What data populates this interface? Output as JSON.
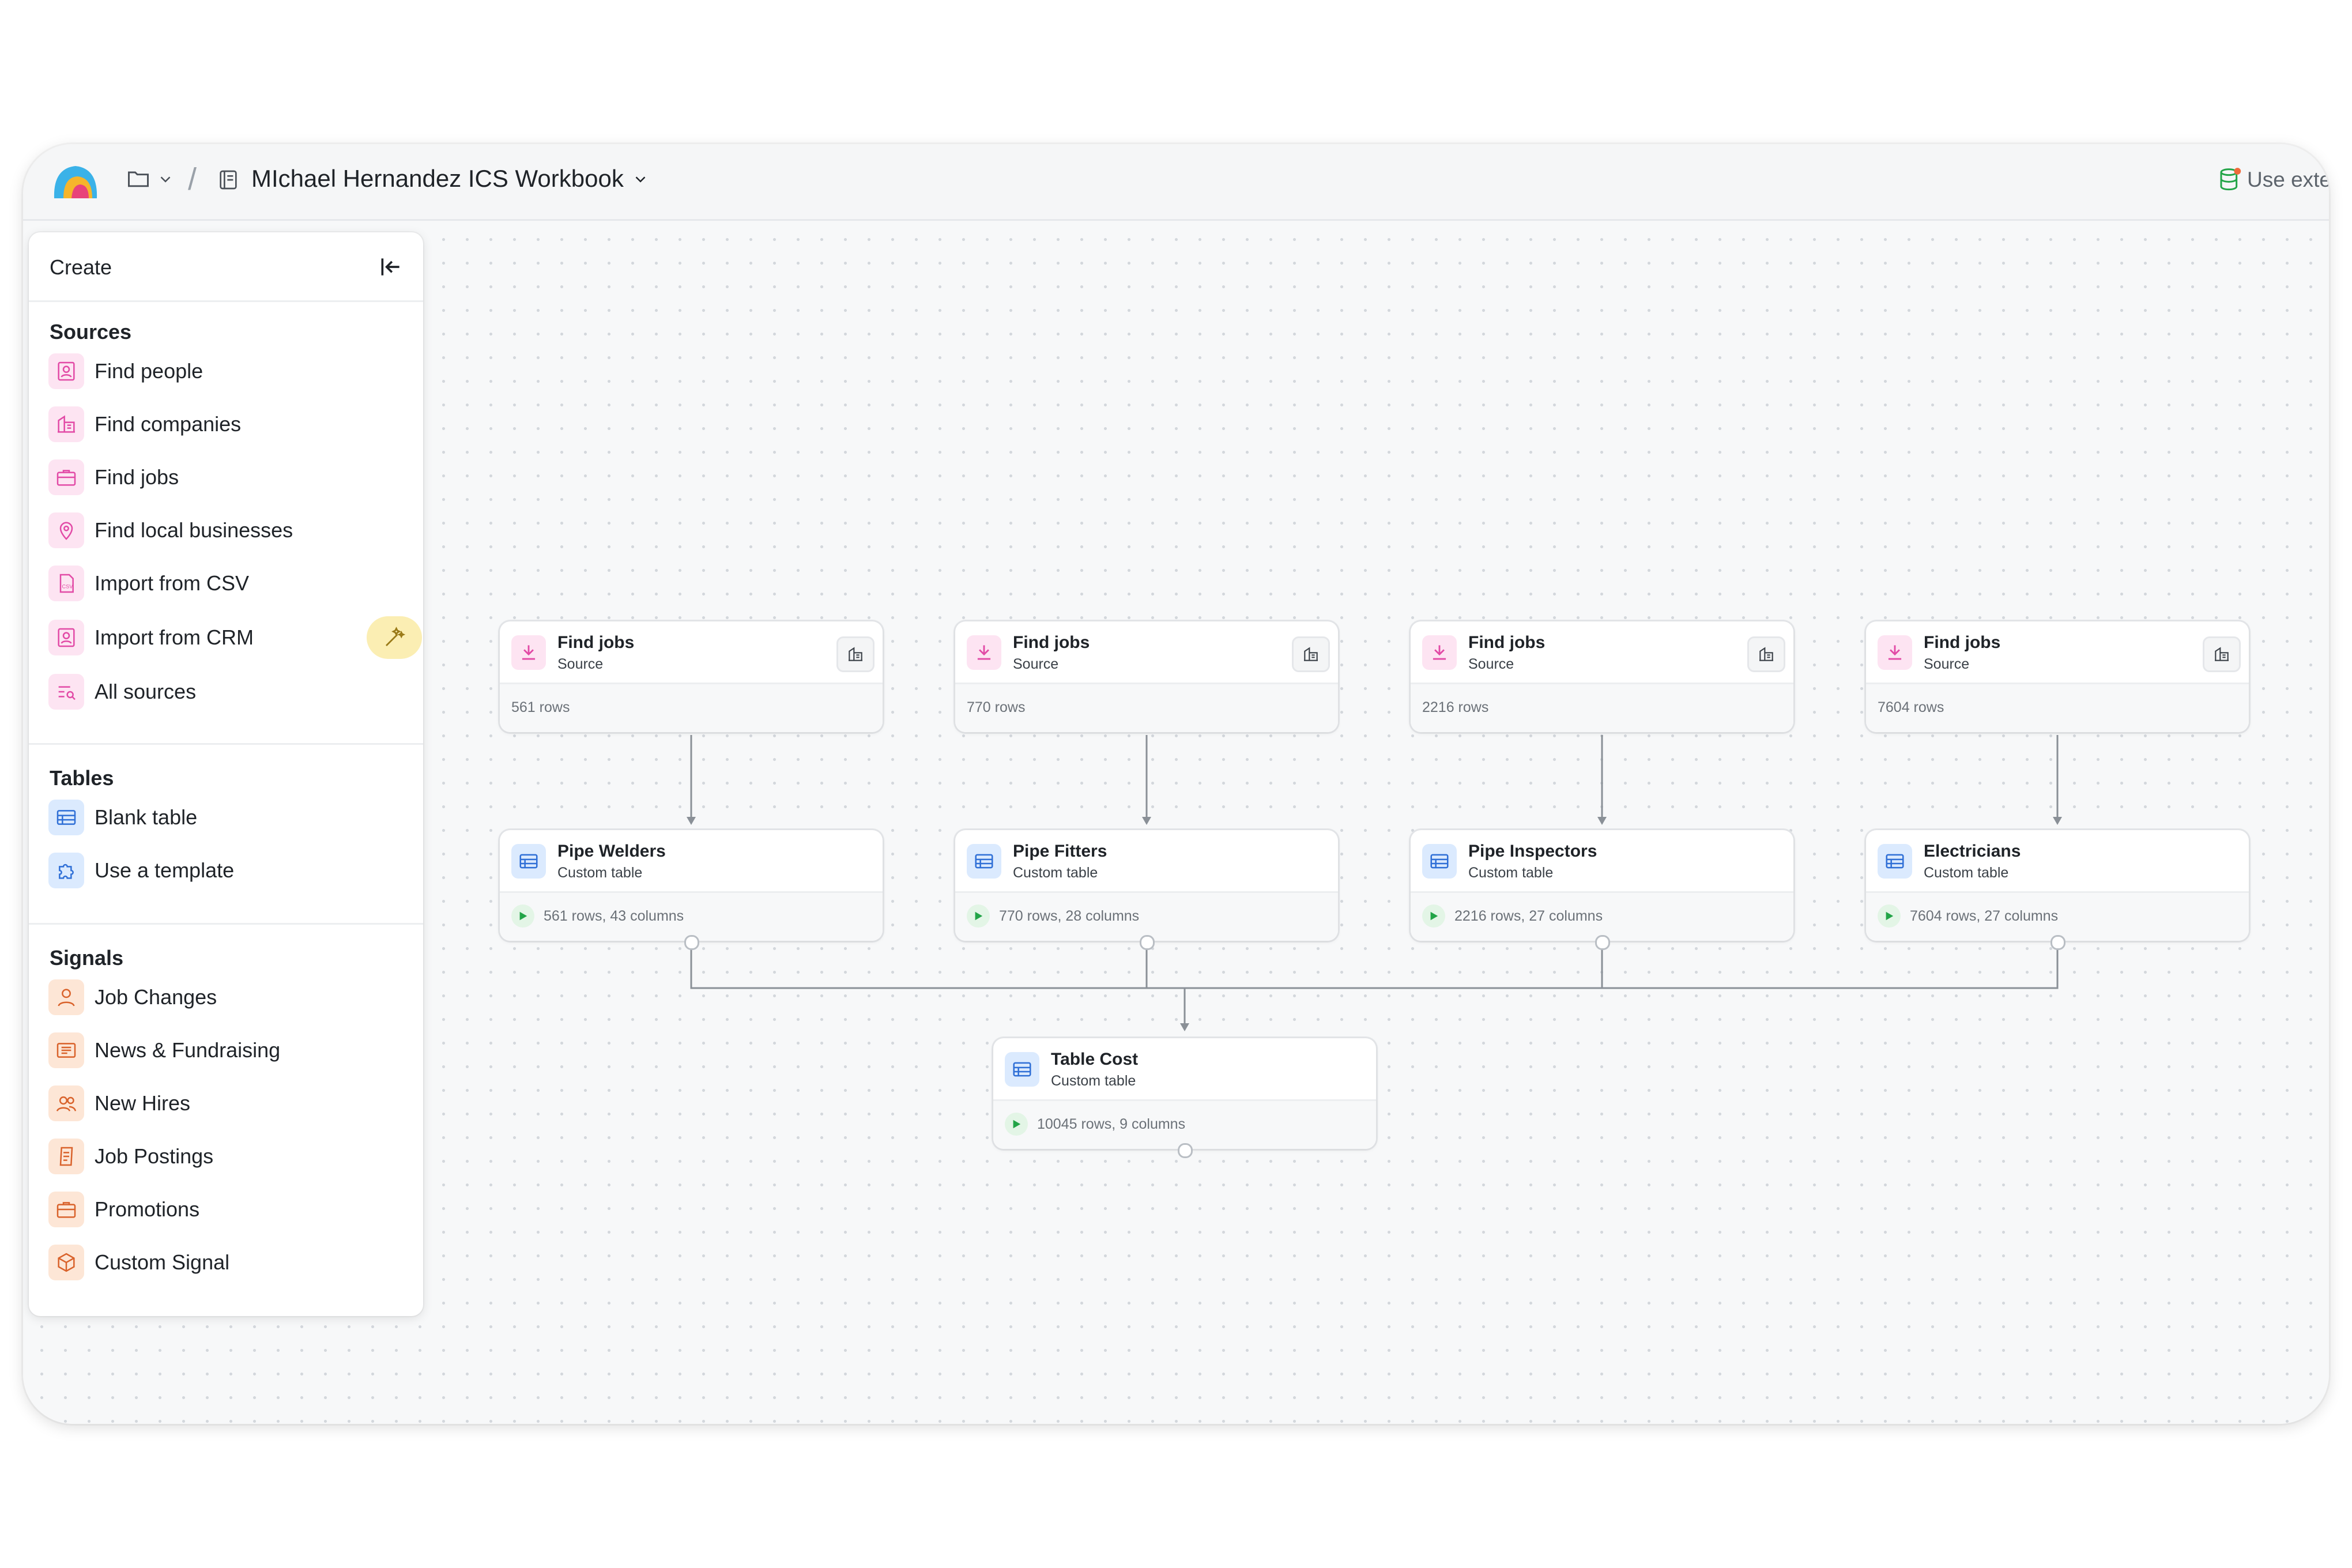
{
  "topbar": {
    "workbook_title": "MIchael Hernandez ICS Workbook",
    "separator": "/",
    "use_external_label": "Use exte"
  },
  "panel": {
    "title": "Create",
    "sections": {
      "sources": {
        "heading": "Sources",
        "items": [
          {
            "label": "Find people",
            "icon": "person-card-icon"
          },
          {
            "label": "Find companies",
            "icon": "building-icon"
          },
          {
            "label": "Find jobs",
            "icon": "briefcase-icon"
          },
          {
            "label": "Find local businesses",
            "icon": "map-pin-icon"
          },
          {
            "label": "Import from CSV",
            "icon": "csv-file-icon"
          },
          {
            "label": "Import from CRM",
            "icon": "crm-icon"
          },
          {
            "label": "All sources",
            "icon": "list-search-icon"
          }
        ]
      },
      "tables": {
        "heading": "Tables",
        "items": [
          {
            "label": "Blank table",
            "icon": "table-icon"
          },
          {
            "label": "Use a template",
            "icon": "puzzle-icon"
          }
        ]
      },
      "signals": {
        "heading": "Signals",
        "items": [
          {
            "label": "Job Changes",
            "icon": "person-icon"
          },
          {
            "label": "News & Fundraising",
            "icon": "newspaper-icon"
          },
          {
            "label": "New Hires",
            "icon": "people-icon"
          },
          {
            "label": "Job Postings",
            "icon": "document-icon"
          },
          {
            "label": "Promotions",
            "icon": "briefcase-icon"
          },
          {
            "label": "Custom Signal",
            "icon": "cube-icon"
          }
        ]
      }
    }
  },
  "flow": {
    "sources": [
      {
        "title": "Find jobs",
        "subtitle": "Source",
        "rows": "561 rows"
      },
      {
        "title": "Find jobs",
        "subtitle": "Source",
        "rows": "770 rows"
      },
      {
        "title": "Find jobs",
        "subtitle": "Source",
        "rows": "2216 rows"
      },
      {
        "title": "Find jobs",
        "subtitle": "Source",
        "rows": "7604 rows"
      }
    ],
    "tables": [
      {
        "title": "Pipe Welders",
        "subtitle": "Custom table",
        "stats": "561 rows, 43 columns"
      },
      {
        "title": "Pipe Fitters",
        "subtitle": "Custom table",
        "stats": "770 rows, 28 columns"
      },
      {
        "title": "Pipe Inspectors",
        "subtitle": "Custom table",
        "stats": "2216 rows, 27 columns"
      },
      {
        "title": "Electricians",
        "subtitle": "Custom table",
        "stats": "7604 rows, 27 columns"
      }
    ],
    "merged": {
      "title": "Table Cost",
      "subtitle": "Custom table",
      "stats": "10045 rows, 9 columns"
    }
  },
  "colors": {
    "source_accent": "#e24aa6",
    "table_accent": "#2f6fd6",
    "signal_accent": "#d9622b",
    "run_green": "#22a447"
  }
}
